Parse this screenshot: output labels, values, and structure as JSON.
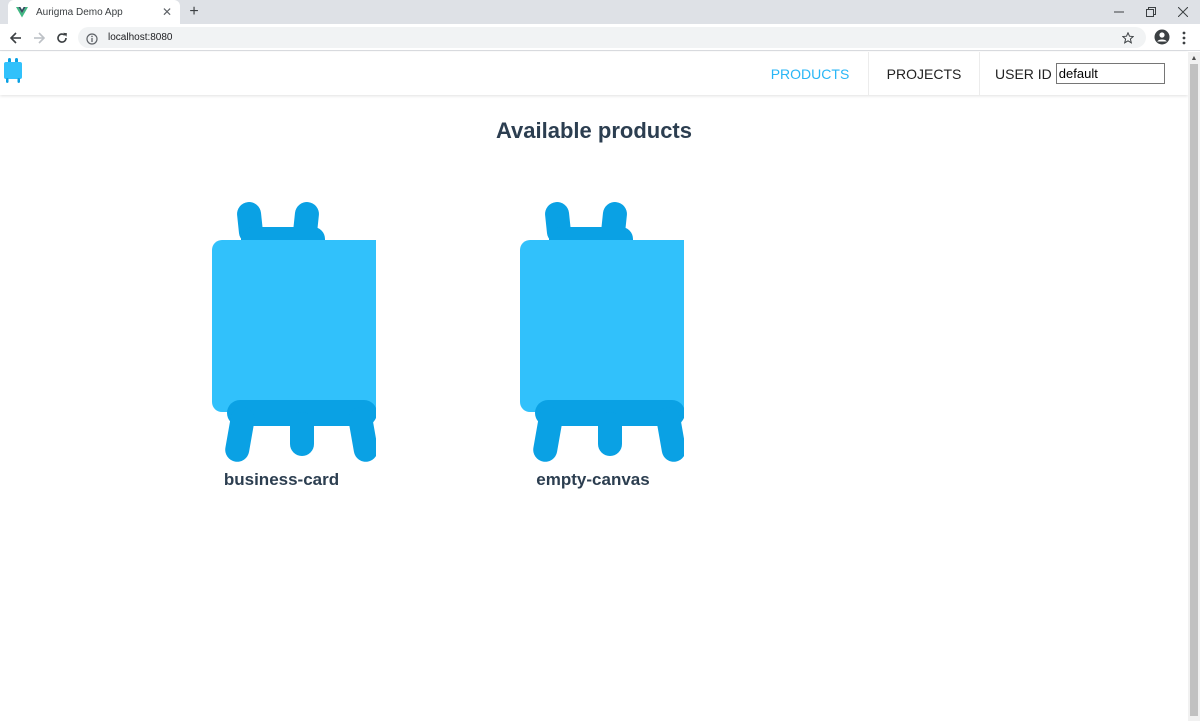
{
  "browser": {
    "tab_title": "Aurigma Demo App",
    "url": "localhost:8080"
  },
  "nav": {
    "products_label": "PRODUCTS",
    "projects_label": "PROJECTS",
    "userid_label": "USER ID",
    "userid_value": "default"
  },
  "main": {
    "heading": "Available products",
    "products": [
      {
        "name": "business-card"
      },
      {
        "name": "empty-canvas"
      }
    ]
  },
  "colors": {
    "accent": "#29b6f6",
    "canvas_light": "#31c1fb",
    "canvas_dark": "#0aa1e4",
    "heading": "#2c3e50"
  }
}
